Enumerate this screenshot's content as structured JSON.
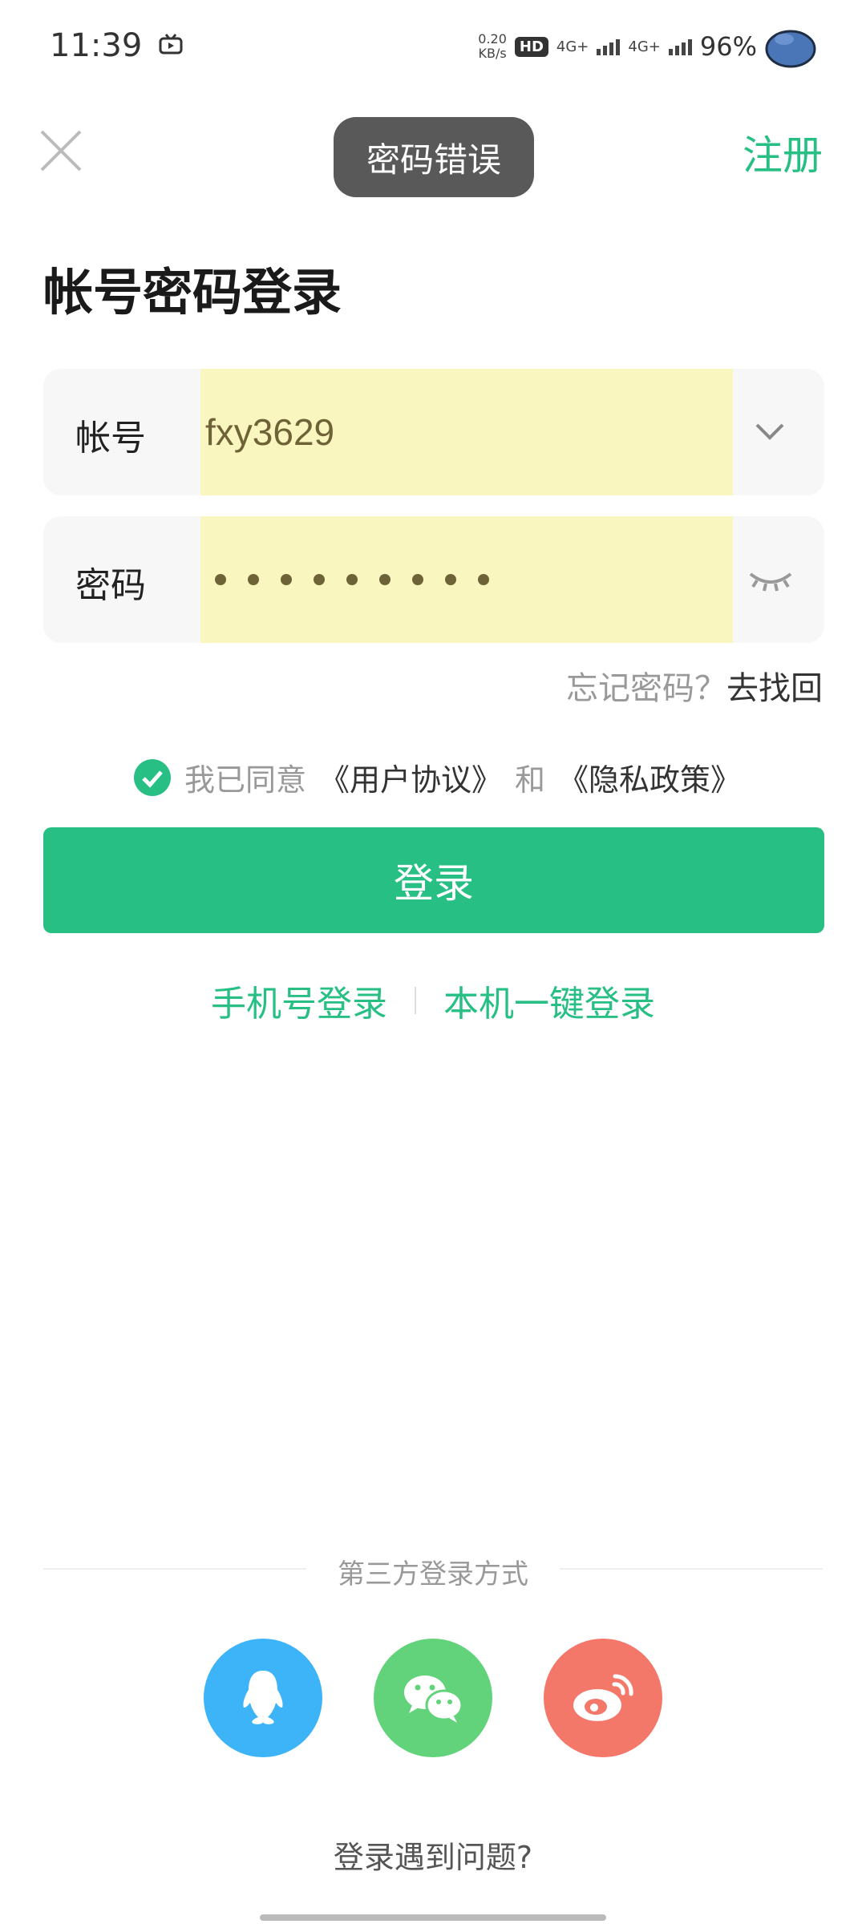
{
  "status_bar": {
    "time": "11:39",
    "net_speed_value": "0.20",
    "net_speed_unit": "KB/s",
    "hd_badge": "HD",
    "network_1": "4G+",
    "network_2": "4G+",
    "battery": "96%"
  },
  "toast": {
    "message": "密码错误"
  },
  "header": {
    "register": "注册"
  },
  "page": {
    "title": "帐号密码登录"
  },
  "account": {
    "label": "帐号",
    "value": "fxy3629"
  },
  "password": {
    "label": "密码",
    "masked_length": 9
  },
  "forgot": {
    "question": "忘记密码？",
    "action": "去找回"
  },
  "agreement": {
    "prefix": "我已同意",
    "user_agreement": "《用户协议》",
    "conjunction": "和",
    "privacy_policy": "《隐私政策》",
    "checked": true
  },
  "login_button": {
    "label": "登录"
  },
  "alt_login": {
    "phone": "手机号登录",
    "one_click": "本机一键登录"
  },
  "third_party": {
    "label": "第三方登录方式",
    "providers": [
      "qq-icon",
      "wechat-icon",
      "weibo-icon"
    ]
  },
  "footer": {
    "trouble": "登录遇到问题?"
  },
  "colors": {
    "accent": "#27bf84",
    "autofill": "#faf6c0",
    "qq": "#3eb4f8",
    "wechat": "#62d37a",
    "weibo": "#f4786a"
  }
}
